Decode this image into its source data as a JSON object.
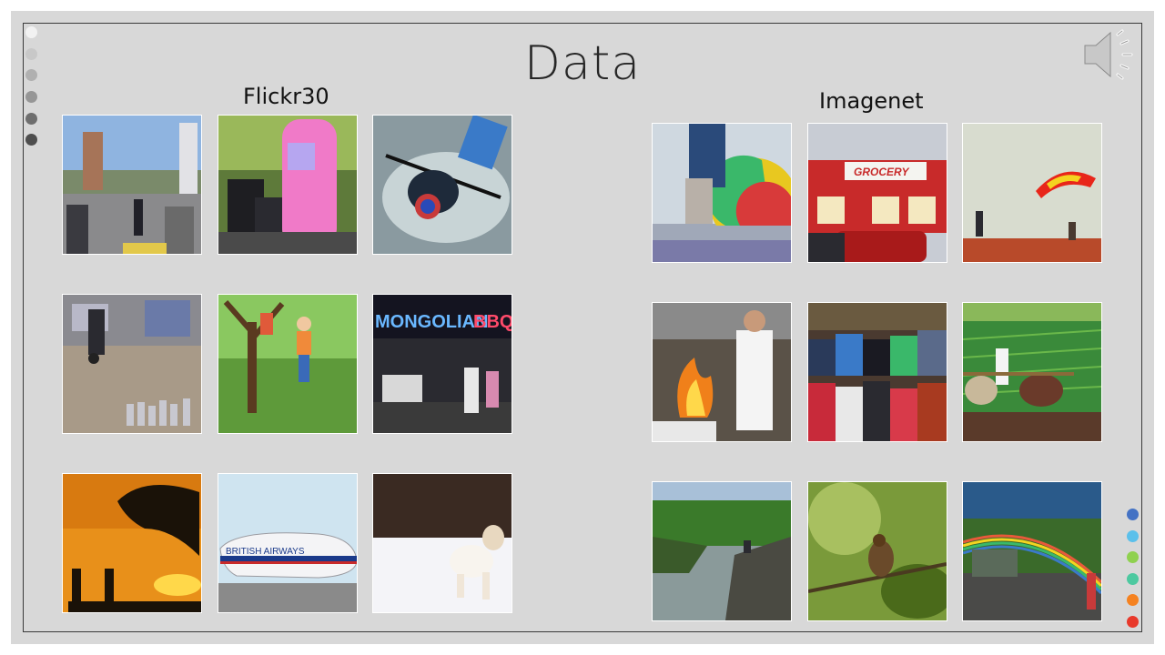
{
  "slide": {
    "title": "Data",
    "groups": [
      {
        "label": "Flickr30"
      },
      {
        "label": "Imagenet"
      }
    ]
  },
  "nav_dots": {
    "colors": [
      "#f2f2f2",
      "#c8c8c8",
      "#b0b0b0",
      "#969696",
      "#6e6e6e",
      "#4e4e4e"
    ]
  },
  "accent_dots": {
    "colors": [
      "#4472c4",
      "#5bc0eb",
      "#8fd14f",
      "#4dc9a0",
      "#f58220",
      "#e8392b"
    ]
  },
  "icons": {
    "audio": "speaker-icon"
  }
}
